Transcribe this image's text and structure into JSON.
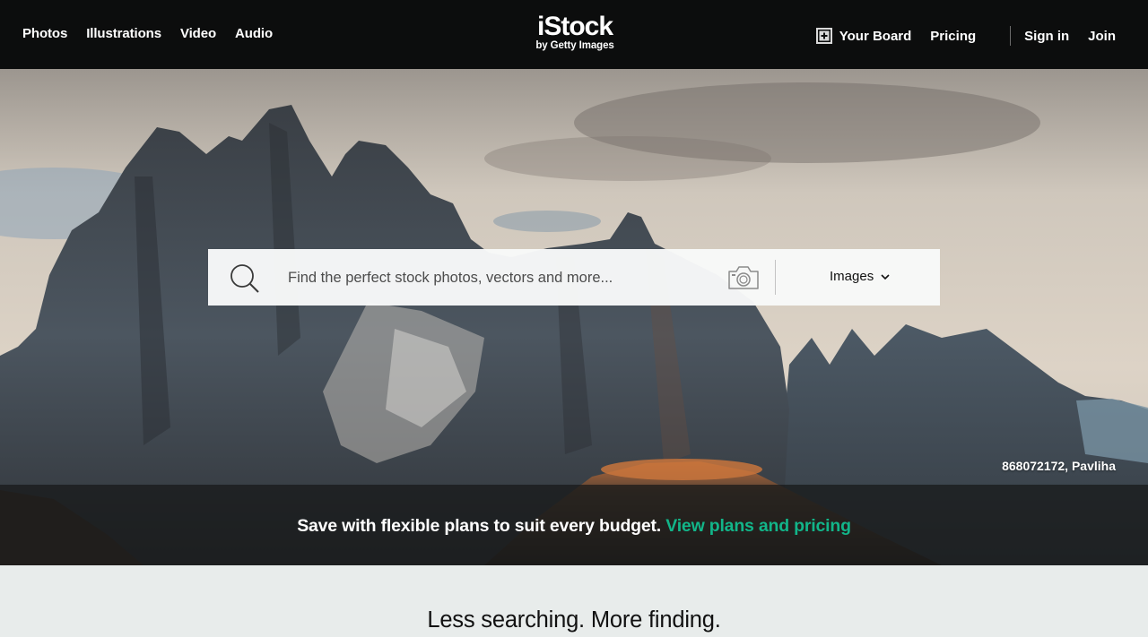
{
  "header": {
    "nav_left": [
      {
        "label": "Photos"
      },
      {
        "label": "Illustrations"
      },
      {
        "label": "Video"
      },
      {
        "label": "Audio"
      }
    ],
    "logo": {
      "main": "iStock",
      "sub": "by Getty Images"
    },
    "board_label": "Your Board",
    "pricing_label": "Pricing",
    "signin_label": "Sign in",
    "join_label": "Join"
  },
  "search": {
    "placeholder": "Find the perfect stock photos, vectors and more...",
    "type_selected": "Images",
    "icons": {
      "search": "search-icon",
      "camera": "camera-icon",
      "chevron": "chevron-down-icon"
    }
  },
  "hero": {
    "credit": "868072172, Pavliha"
  },
  "promo": {
    "text": "Save with flexible plans to suit every budget.",
    "link": "View plans and pricing"
  },
  "tagline": "Less searching. More finding.",
  "colors": {
    "header_bg": "#0c0d0d",
    "accent": "#12b589",
    "page_bg": "#e8eceb"
  }
}
